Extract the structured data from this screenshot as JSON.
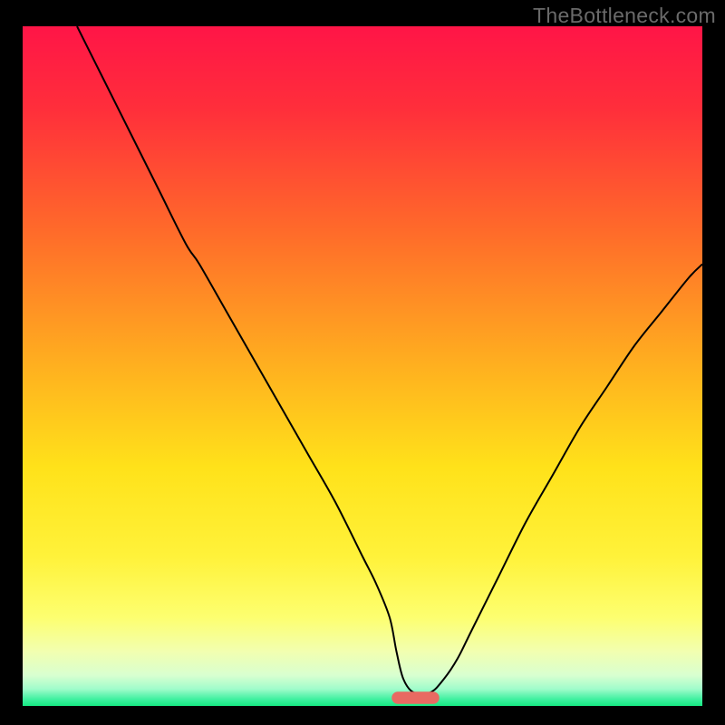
{
  "watermark": "TheBottleneck.com",
  "chart_data": {
    "type": "line",
    "title": "",
    "xlabel": "",
    "ylabel": "",
    "xlim": [
      0,
      100
    ],
    "ylim": [
      0,
      100
    ],
    "grid": false,
    "legend": false,
    "gradient_stops": [
      {
        "offset": 0.0,
        "color": "#ff1547"
      },
      {
        "offset": 0.12,
        "color": "#ff2e3b"
      },
      {
        "offset": 0.3,
        "color": "#ff6a2a"
      },
      {
        "offset": 0.5,
        "color": "#ffb01f"
      },
      {
        "offset": 0.65,
        "color": "#ffe21a"
      },
      {
        "offset": 0.78,
        "color": "#fff23a"
      },
      {
        "offset": 0.87,
        "color": "#fdff70"
      },
      {
        "offset": 0.92,
        "color": "#f2ffb0"
      },
      {
        "offset": 0.955,
        "color": "#d8ffd0"
      },
      {
        "offset": 0.975,
        "color": "#a0fccb"
      },
      {
        "offset": 0.99,
        "color": "#40f0a0"
      },
      {
        "offset": 1.0,
        "color": "#15e882"
      }
    ],
    "series": [
      {
        "name": "bottleneck-curve",
        "color": "#000000",
        "x": [
          8.0,
          12,
          16,
          20,
          24,
          26,
          30,
          34,
          38,
          42,
          46,
          50,
          52,
          54,
          55,
          56,
          57.5,
          60,
          62,
          64,
          66,
          70,
          74,
          78,
          82,
          86,
          90,
          94,
          98,
          100
        ],
        "y": [
          100,
          92,
          84,
          76,
          68,
          65,
          58,
          51,
          44,
          37,
          30,
          22,
          18,
          13,
          8,
          4,
          2,
          2,
          4,
          7,
          11,
          19,
          27,
          34,
          41,
          47,
          53,
          58,
          63,
          65
        ]
      }
    ],
    "marker": {
      "name": "optimal-bar",
      "color": "#e86a62",
      "x_center": 57.8,
      "y": 1.2,
      "width": 7.0,
      "height": 1.8,
      "rx": 0.9
    }
  }
}
